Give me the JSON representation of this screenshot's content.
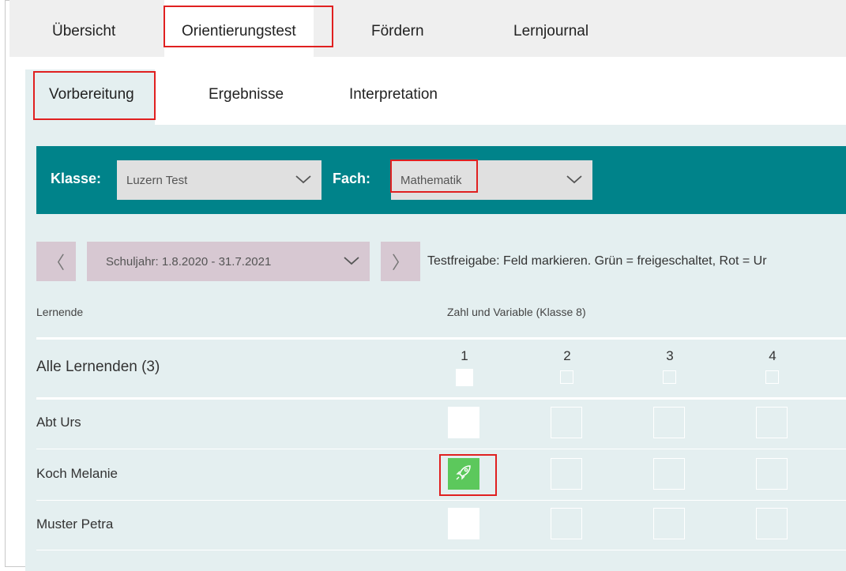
{
  "main_tabs": [
    {
      "label": "Übersicht"
    },
    {
      "label": "Orientierungstest"
    },
    {
      "label": "Fördern"
    },
    {
      "label": "Lernjournal"
    }
  ],
  "sub_tabs": [
    {
      "label": "Vorbereitung"
    },
    {
      "label": "Ergebnisse"
    },
    {
      "label": "Interpretation"
    }
  ],
  "filters": {
    "klasse_label": "Klasse:",
    "klasse_value": "Luzern Test",
    "fach_label": "Fach:",
    "fach_value": "Mathematik"
  },
  "year": {
    "prev_icon": "chevron-left-icon",
    "value": "Schuljahr: 1.8.2020 - 31.7.2021",
    "next_icon": "chevron-right-icon",
    "prev_glyph": "〈",
    "next_glyph": "〉"
  },
  "hint": "Testfreigabe: Feld markieren. Grün = freigeschaltet, Rot = Ur",
  "table": {
    "learners_header": "Lernende",
    "topic_header": "Zahl und Variable (Klasse 8)",
    "columns": [
      "1",
      "2",
      "3",
      "4"
    ],
    "all_label": "Alle Lernenden (3)",
    "rows": [
      {
        "name": "Abt Urs"
      },
      {
        "name": "Koch Melanie"
      },
      {
        "name": "Muster Petra"
      }
    ]
  },
  "colors": {
    "accent": "#00838a",
    "released": "#5cc85c",
    "highlight": "#e02020",
    "content_bg": "#e4eff0"
  }
}
